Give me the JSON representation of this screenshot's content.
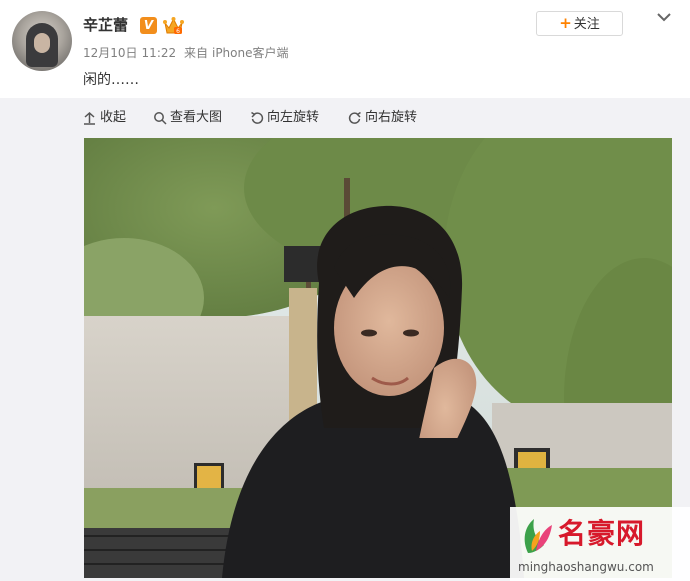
{
  "post": {
    "username": "辛芷蕾",
    "verified_badge": "V",
    "date": "12月10日",
    "time": "11:22",
    "source_prefix": "来自",
    "source": "iPhone客户端",
    "content": "闲的……"
  },
  "actions": {
    "follow_icon": "+",
    "follow_label": "关注",
    "more_icon": "chevron-down-icon"
  },
  "toolbar": {
    "collapse": "收起",
    "view_large": "查看大图",
    "rotate_left": "向左旋转",
    "rotate_right": "向右旋转"
  },
  "watermark": {
    "name": "名豪网",
    "url": "minghaoshangwu.com"
  },
  "colors": {
    "accent": "#ff8200",
    "verified": "#f28e1c",
    "watermark_red": "#d7192b",
    "meta_text": "#808080"
  }
}
